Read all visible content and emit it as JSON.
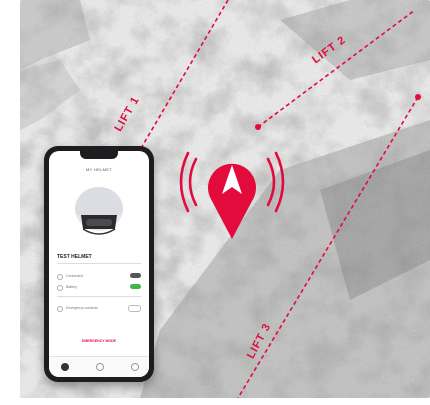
{
  "map": {
    "lifts": [
      {
        "label": "LIFT 1"
      },
      {
        "label": "LIFT 2"
      },
      {
        "label": "LIFT 3"
      }
    ]
  },
  "colors": {
    "accent": "#e30a3c",
    "pin_arrow": "#ffffff",
    "snow": "#efefef",
    "forest": "#8c8c8c"
  },
  "pin": {
    "icon": "location-pin-arrow-icon",
    "signal_icon": "signal-waves-icon"
  },
  "phone": {
    "title": "MY HELMET",
    "helmet_name": "TEST HELMET",
    "rows": [
      "Connected",
      "Battery",
      "Emergency contacts"
    ],
    "emergency": "EMERGENCY MODE"
  }
}
